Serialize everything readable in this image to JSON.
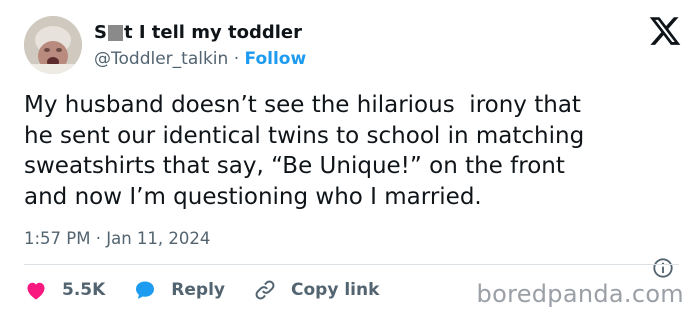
{
  "author": {
    "name_prefix": "S",
    "name_suffix": "t I tell my toddler",
    "handle": "@Toddler_talkin",
    "separator": "·",
    "follow_label": "Follow"
  },
  "tweet": {
    "text": "My husband doesn’t see the hilarious  irony that\nhe sent our identical twins to school in matching\nsweatshirts that say, “Be Unique!” on the front\nand now I’m questioning who I married.",
    "timestamp": "1:57 PM · Jan 11, 2024"
  },
  "actions": {
    "likes_count": "5.5K",
    "reply_label": "Reply",
    "copy_link_label": "Copy link"
  },
  "watermark": "boredpanda.com",
  "colors": {
    "accent": "#1d9bf0",
    "like": "#f91880",
    "text": "#0f1419",
    "secondary": "#536471"
  },
  "icons": {
    "logo": "x-logo-icon",
    "like": "heart-icon",
    "reply": "speech-bubble-icon",
    "copy": "link-icon",
    "info": "info-icon"
  }
}
